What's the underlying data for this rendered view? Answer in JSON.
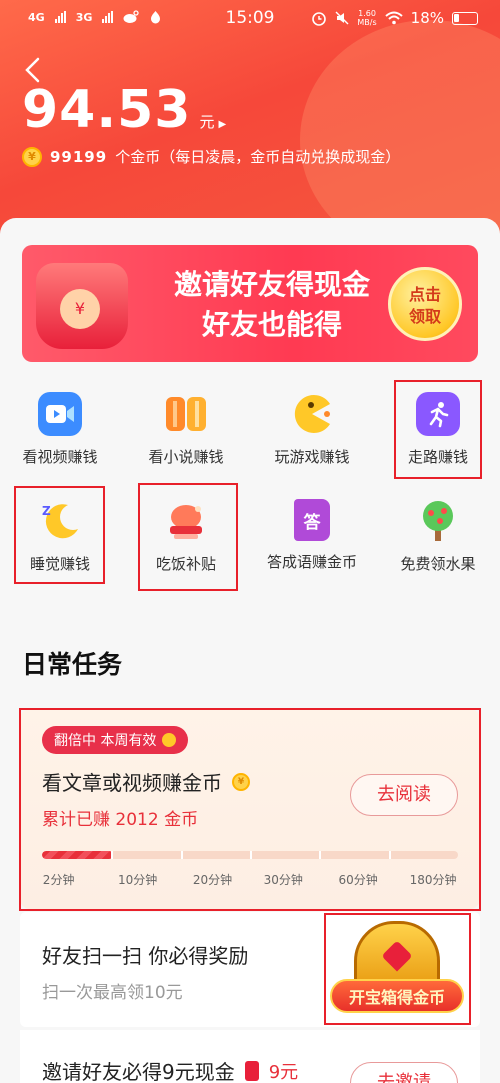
{
  "status_bar": {
    "network_1": "4G",
    "network_2": "3G",
    "time": "15:09",
    "speed": "1.60\nMB/s",
    "battery": "18%"
  },
  "wallet": {
    "balance": "94.53",
    "unit": "元",
    "coin_icon": "¥",
    "coin_count": "99199",
    "coin_note": "个金币（每日凌晨，金币自动兑换成现金）"
  },
  "banner": {
    "line1": "邀请好友得现金",
    "line2": "好友也能得",
    "button_line1": "点击",
    "button_line2": "领取"
  },
  "features": [
    {
      "label": "看视频赚钱",
      "icon": "video-camera-icon"
    },
    {
      "label": "看小说赚钱",
      "icon": "book-icon"
    },
    {
      "label": "玩游戏赚钱",
      "icon": "pacman-game-icon"
    },
    {
      "label": "走路赚钱",
      "icon": "walking-person-icon"
    },
    {
      "label": "睡觉赚钱",
      "icon": "moon-sleep-icon"
    },
    {
      "label": "吃饭补贴",
      "icon": "chicken-leg-icon"
    },
    {
      "label": "答成语赚金币",
      "icon": "idiom-book-icon",
      "icon_text": "答"
    },
    {
      "label": "免费领水果",
      "icon": "fruit-tree-icon"
    }
  ],
  "daily_tasks": {
    "title": "日常任务",
    "task1": {
      "tag": "翻倍中 本周有效",
      "title": "看文章或视频赚金币",
      "earned": "累计已赚 2012 金币",
      "button": "去阅读",
      "progress": 0.17,
      "ticks": [
        "2分钟",
        "10分钟",
        "20分钟",
        "30分钟",
        "60分钟",
        "180分钟"
      ]
    },
    "task2": {
      "title": "好友扫一扫 你必得奖励",
      "subtitle": "扫一次最高领10元",
      "chest_label": "开宝箱得金币"
    },
    "task3": {
      "title": "邀请好友必得9元现金",
      "amount": "9元",
      "button": "去邀请"
    }
  },
  "colors": {
    "header": "#f6483a",
    "accent_red": "#e8303a",
    "highlight_box": "#e8202a"
  }
}
